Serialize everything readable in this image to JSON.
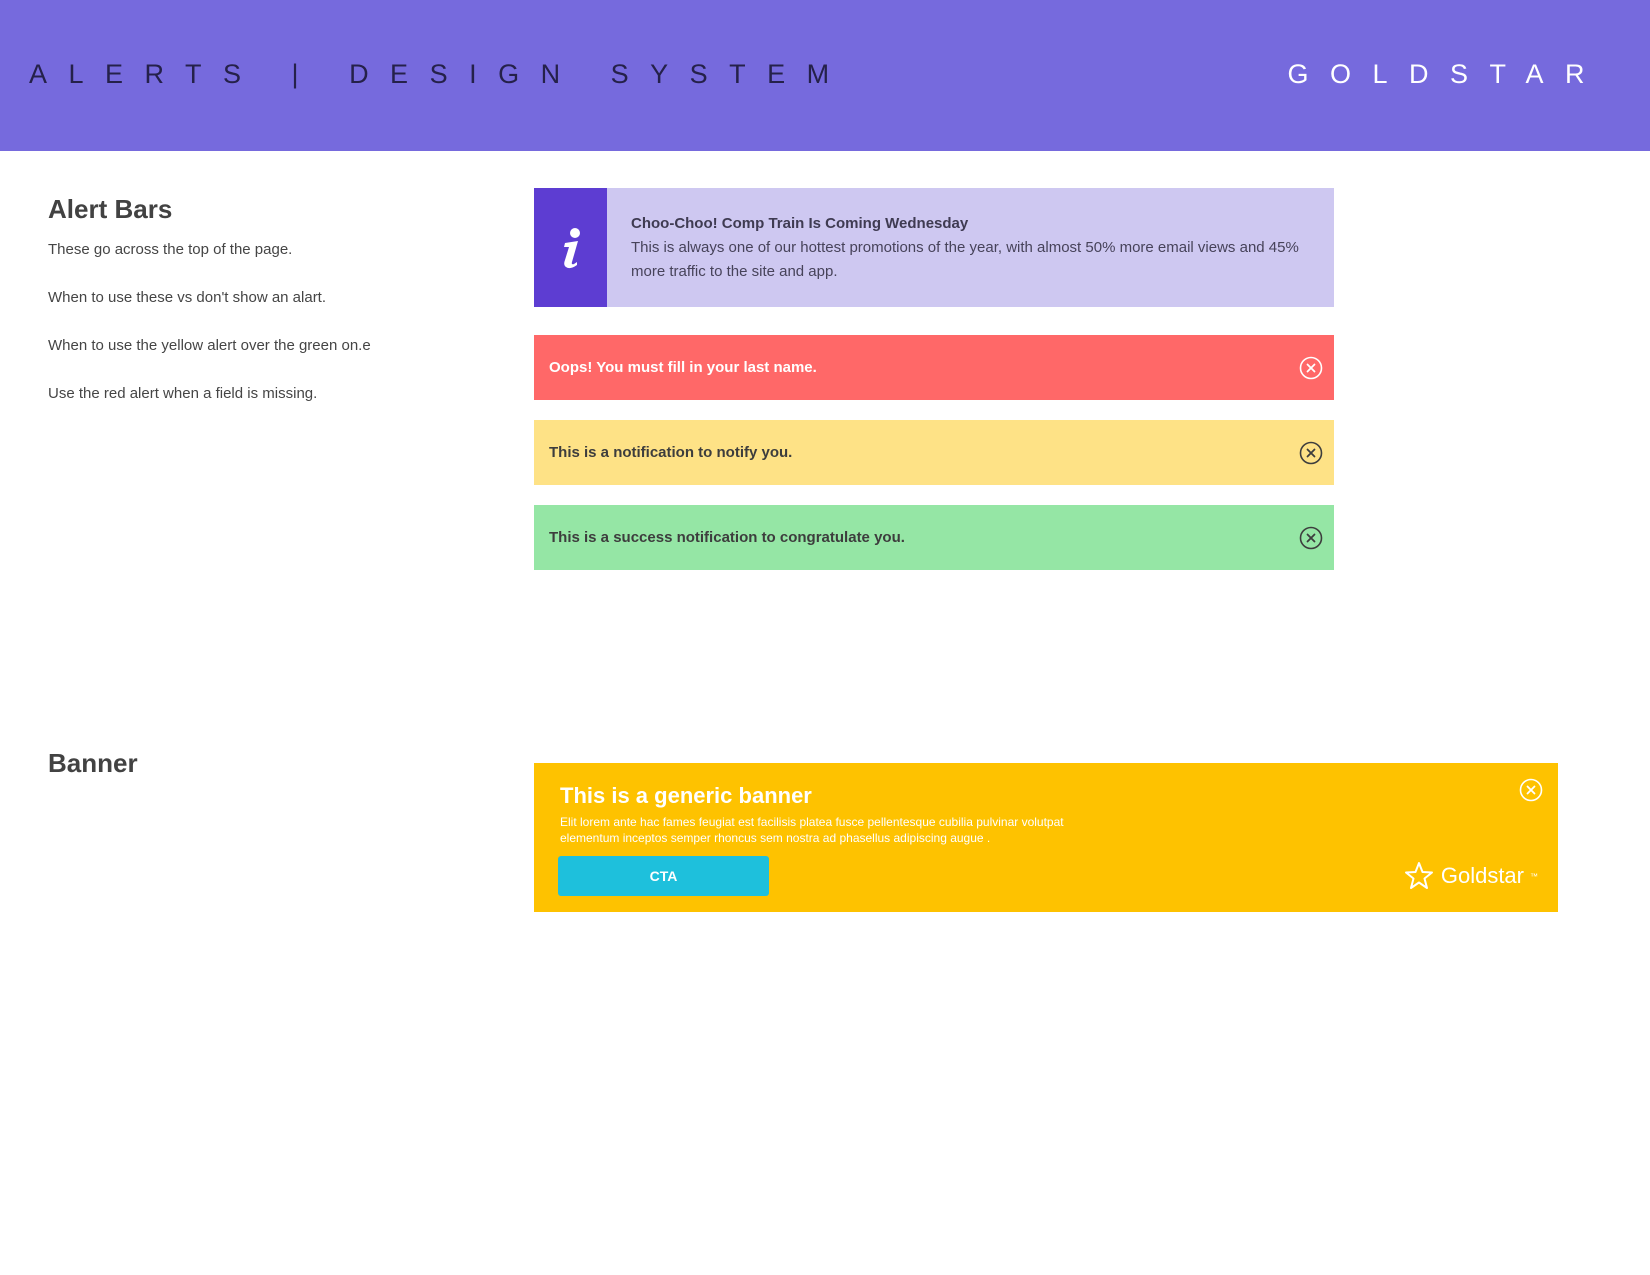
{
  "header": {
    "title": "ALERTS | DESIGN SYSTEM",
    "brand": "GOLDSTAR"
  },
  "alert_bars_section": {
    "title": "Alert Bars",
    "notes": [
      "These go across the top of the page.",
      "When to use these vs don't show an alart.",
      "When to use the yellow alert over the green on.e",
      "Use the red alert when a field is missing."
    ]
  },
  "info_alert": {
    "icon": "info-icon",
    "title": "Choo-Choo! Comp Train Is Coming Wednesday",
    "body": "This is always one of our hottest promotions of the year, with almost 50% more email views and 45% more traffic to the site and app."
  },
  "error_bar": {
    "text": "Oops! You must fill in your last name.",
    "icon": "close-circle-icon",
    "color": "#ff6868"
  },
  "warning_bar": {
    "text": "This is a notification to notify you.",
    "icon": "close-circle-icon",
    "color": "#fee286"
  },
  "success_bar": {
    "text": "This is a success notification to congratulate you.",
    "icon": "close-circle-icon",
    "color": "#95e6a5"
  },
  "banner_section": {
    "title": "Banner"
  },
  "banner": {
    "title": "This is a generic banner",
    "body": "Elit lorem ante hac fames feugiat est facilisis platea fusce pellentesque cubilia pulvinar volutpat elementum inceptos semper rhoncus sem nostra ad phasellus adipiscing augue .",
    "cta_label": "CTA",
    "logo_text": "Goldstar",
    "logo_tm": "™",
    "color": "#fec200",
    "cta_color": "#1ec0dc"
  },
  "colors": {
    "header": "#766add",
    "info_icon_bg": "#5d3dd2",
    "info_bg": "#cec8f1"
  }
}
